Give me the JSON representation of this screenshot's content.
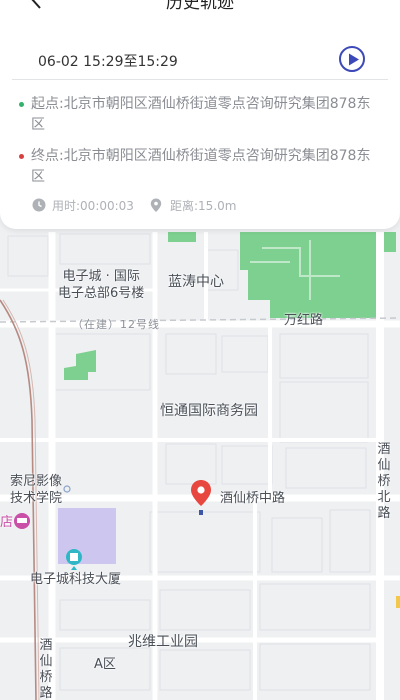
{
  "header": {
    "title": "历史轨迹",
    "back_icon": "chevron-left-icon"
  },
  "trip": {
    "date_range": "06-02 15:29至15:29",
    "play_icon": "play-circle-icon",
    "start": {
      "label": "起点:",
      "address": "北京市朝阳区酒仙桥街道零点咨询研究集团878东区",
      "dot_color": "#31b36b"
    },
    "end": {
      "label": "终点:",
      "address": "北京市朝阳区酒仙桥街道零点咨询研究集团878东区",
      "dot_color": "#d8403f"
    },
    "duration": "用时:00:00:03",
    "distance": "距离:15.0m"
  },
  "colors": {
    "accent": "#3c49b8",
    "marker": "#e8473f",
    "park_green": "#7dd08f"
  },
  "map": {
    "labels": {
      "dianzicheng_line1": "电子城 · 国际",
      "dianzicheng_line2": "电子总部6号楼",
      "lantao": "蓝涛中心",
      "rail_line": "（在建）12号线",
      "wanhong": "万红路",
      "hengtong": "恒通国际商务园",
      "sony_line1": "索尼影像",
      "sony_line2": "技术学院",
      "hotel_fragment": "店",
      "jxq_zhonglu": "酒仙桥中路",
      "jxq_beilu": "酒仙桥北路",
      "dianzi_tech": "电子城科技大厦",
      "zhaowei": "兆维工业园",
      "a_zone": "A区",
      "jxq_road_left": "酒仙桥路"
    }
  }
}
